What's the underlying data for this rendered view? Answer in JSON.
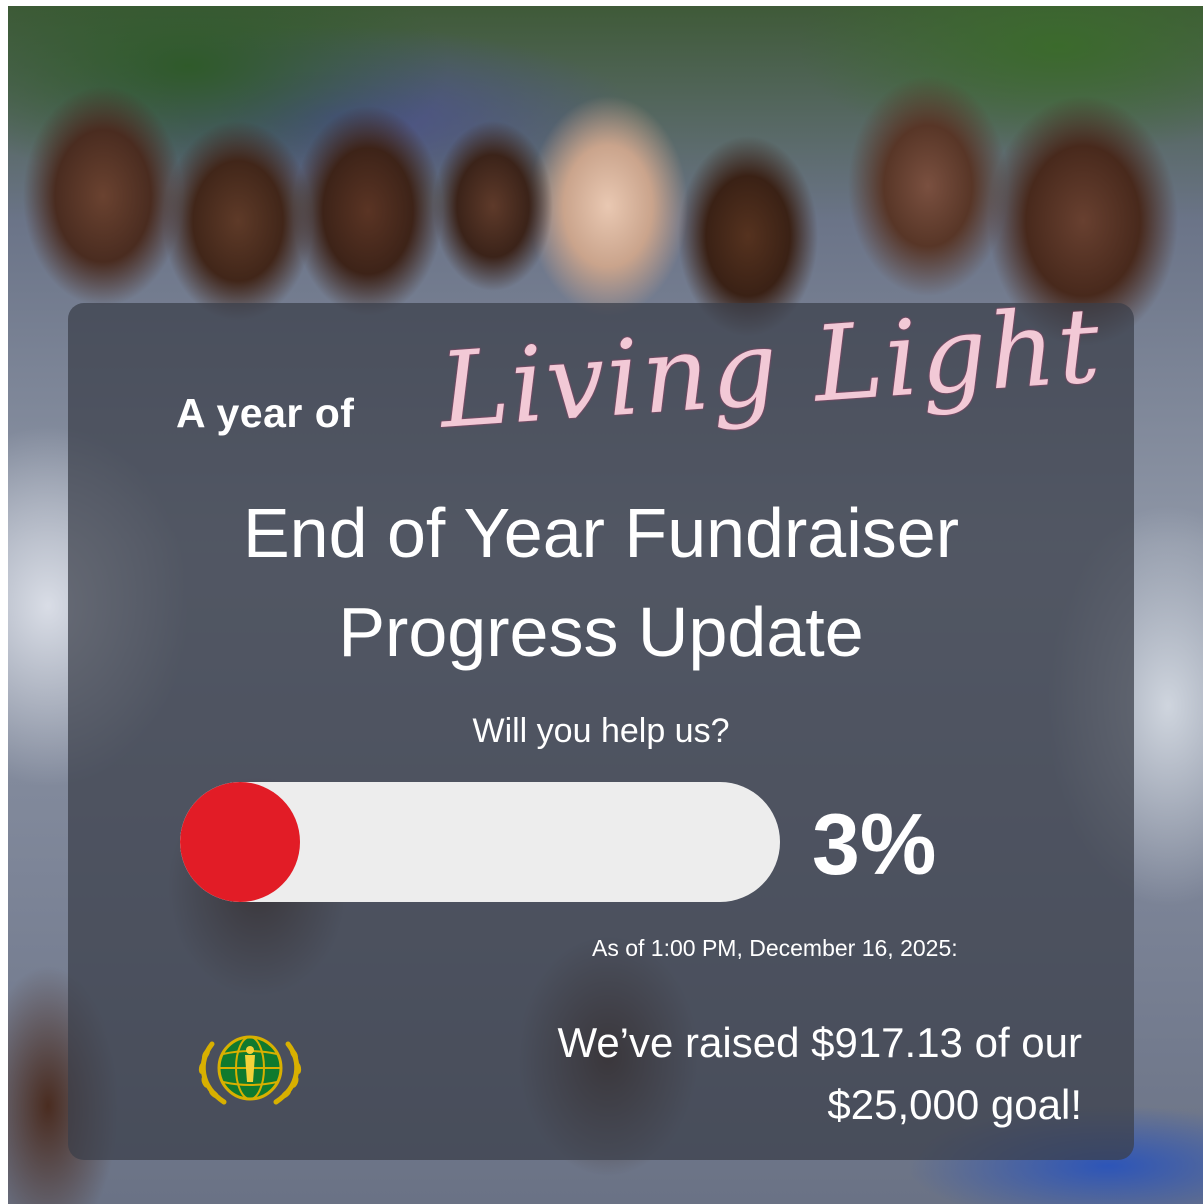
{
  "header": {
    "kicker": "A year of",
    "script_title": "Living Light"
  },
  "title": {
    "line1": "End of Year Fundraiser",
    "line2": "Progress Update"
  },
  "ask": "Will you help us?",
  "progress": {
    "percent_label": "3%",
    "fraction": 0.03,
    "fill_color": "#e21c26",
    "track_color": "#ededed"
  },
  "status": {
    "as_of": "As of 1:00 PM, December 16, 2025:",
    "raised_line1": "We’ve raised $917.13 of our",
    "raised_line2": "$25,000 goal!"
  },
  "logo": {
    "icon": "globe-wreath-emblem-icon",
    "color": "#d8b000"
  }
}
